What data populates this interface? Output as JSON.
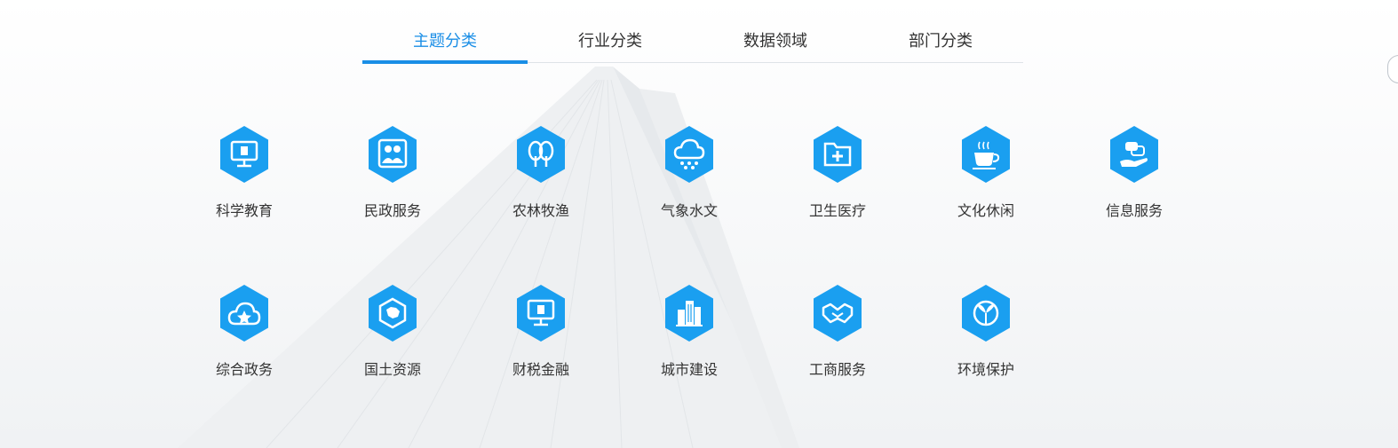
{
  "tabs": [
    {
      "label": "主题分类",
      "active": true
    },
    {
      "label": "行业分类",
      "active": false
    },
    {
      "label": "数据领域",
      "active": false
    },
    {
      "label": "部门分类",
      "active": false
    }
  ],
  "accent_color": "#1a8ee6",
  "icon_color": "#1a9ff0",
  "categories": [
    {
      "label": "科学教育",
      "icon": "monitor-icon"
    },
    {
      "label": "民政服务",
      "icon": "family-icon"
    },
    {
      "label": "农林牧渔",
      "icon": "trees-icon"
    },
    {
      "label": "气象水文",
      "icon": "cloud-snow-icon"
    },
    {
      "label": "卫生医疗",
      "icon": "medical-folder-icon"
    },
    {
      "label": "文化休闲",
      "icon": "coffee-cup-icon"
    },
    {
      "label": "信息服务",
      "icon": "chat-hand-icon"
    },
    {
      "label": "综合政务",
      "icon": "cloud-star-icon"
    },
    {
      "label": "国土资源",
      "icon": "map-icon"
    },
    {
      "label": "财税金融",
      "icon": "finance-monitor-icon"
    },
    {
      "label": "城市建设",
      "icon": "buildings-icon"
    },
    {
      "label": "工商服务",
      "icon": "handshake-icon"
    },
    {
      "label": "环境保护",
      "icon": "leaf-globe-icon"
    }
  ]
}
